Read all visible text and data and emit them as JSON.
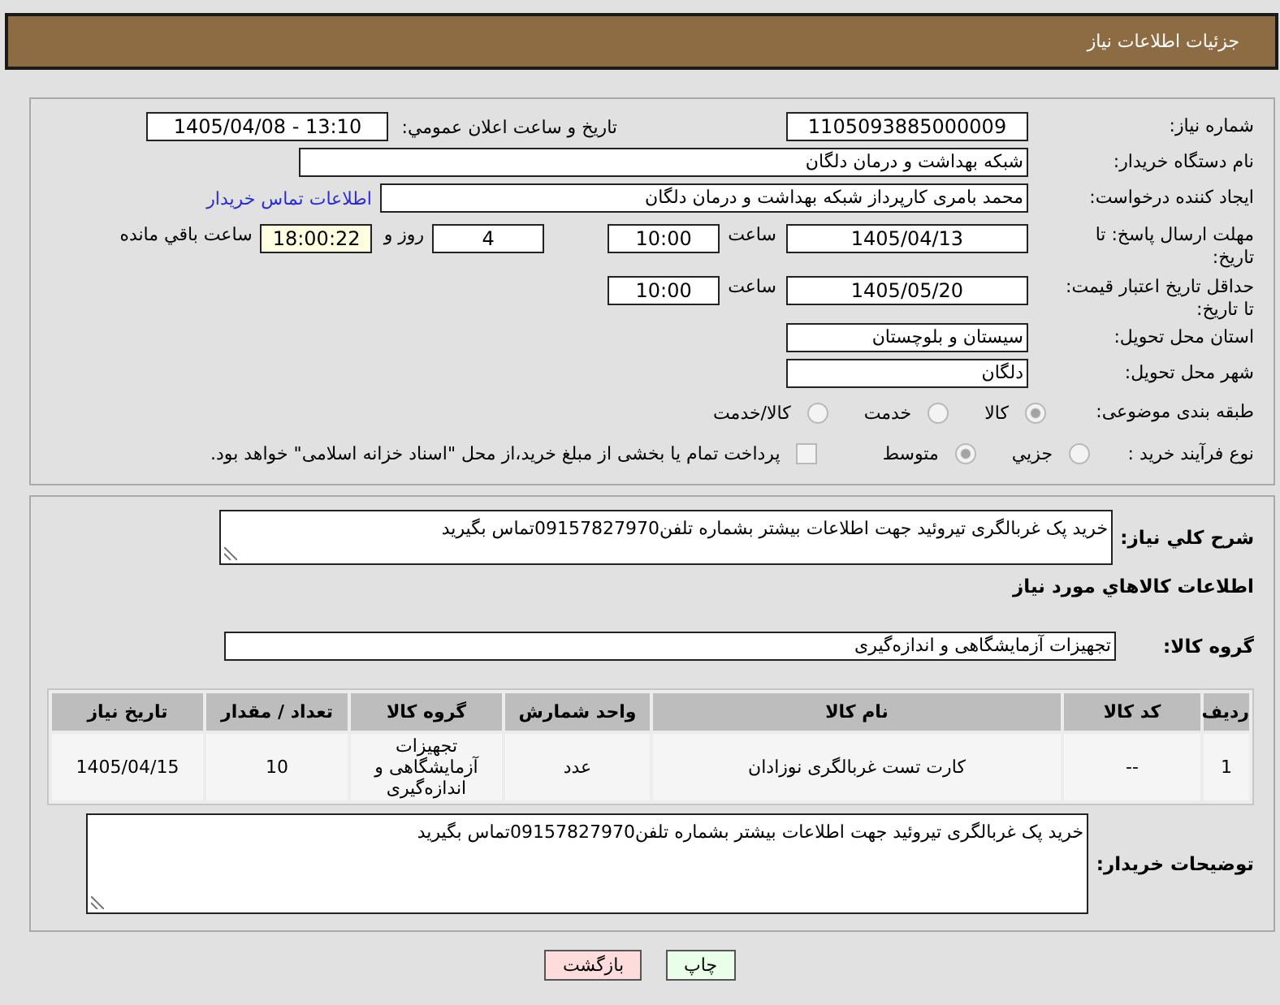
{
  "header": {
    "title": "جزئیات اطلاعات نیاز"
  },
  "need": {
    "number": {
      "label": "شماره نیاز:",
      "value": "1105093885000009"
    },
    "announced": {
      "label": "تاریخ و ساعت اعلان عمومي:",
      "value": "1405/04/08 - 13:10"
    },
    "buyer": {
      "label": "نام دستگاه خریدار:",
      "value": "شبکه بهداشت و درمان دلگان"
    },
    "creator": {
      "label": "ایجاد کننده درخواست:",
      "value": "محمد بامری کارپرداز شبکه بهداشت و درمان دلگان",
      "link": "اطلاعات تماس خریدار"
    },
    "deadline": {
      "label": "مهلت ارسال پاسخ: تا تاریخ:",
      "date": "1405/04/13",
      "time_label": "ساعت",
      "time": "10:00",
      "days": "4",
      "days_label": "روز و",
      "remaining": "18:00:22",
      "remaining_label": "ساعت باقي مانده"
    },
    "validity": {
      "label": "حداقل تاریخ اعتبار قیمت: تا تاریخ:",
      "date": "1405/05/20",
      "time_label": "ساعت",
      "time": "10:00"
    },
    "province": {
      "label": "استان محل تحویل:",
      "value": "سیستان و بلوچستان"
    },
    "city": {
      "label": "شهر محل تحویل:",
      "value": "دلگان"
    },
    "category": {
      "label": "طبقه بندی موضوعی:",
      "options": [
        {
          "label": "کالا",
          "selected": true
        },
        {
          "label": "خدمت",
          "selected": false
        },
        {
          "label": "کالا/خدمت",
          "selected": false
        }
      ]
    },
    "process": {
      "label": "نوع فرآیند خرید :",
      "options": [
        {
          "label": "جزيي",
          "selected": false
        },
        {
          "label": "متوسط",
          "selected": true
        }
      ],
      "treasury": {
        "label": "پرداخت تمام یا بخشی از مبلغ خرید،از محل \"اسناد خزانه اسلامی\" خواهد بود.",
        "checked": false
      }
    }
  },
  "goods": {
    "description": {
      "label": "شرح کلي نياز:",
      "value": "خرید پک غربالگری تیروئید جهت اطلاعات بیشتر بشماره تلفن09157827970تماس بگیرید"
    },
    "section_title": "اطلاعات کالاهاي مورد نياز",
    "group": {
      "label": "گروه کالا:",
      "value": "تجهیزات آزمایشگاهی و اندازه‌گیری"
    },
    "table": {
      "columns": [
        "ردیف",
        "کد کالا",
        "نام کالا",
        "واحد شمارش",
        "گروه کالا",
        "تعداد / مقدار",
        "تاریخ نیاز"
      ],
      "rows": [
        [
          "1",
          "--",
          "کارت تست غربالگری نوزادان",
          "عدد",
          "تجهیزات آزمایشگاهی و اندازه‌گیری",
          "10",
          "1405/04/15"
        ]
      ]
    },
    "buyer_notes": {
      "label": "توضیحات خریدار:",
      "value": "خرید پک غربالگری تیروئید جهت اطلاعات بیشتر بشماره تلفن09157827970تماس بگیرید"
    }
  },
  "buttons": [
    {
      "label": "چاپ",
      "kind": "print"
    },
    {
      "label": "بازگشت",
      "kind": "back"
    }
  ]
}
